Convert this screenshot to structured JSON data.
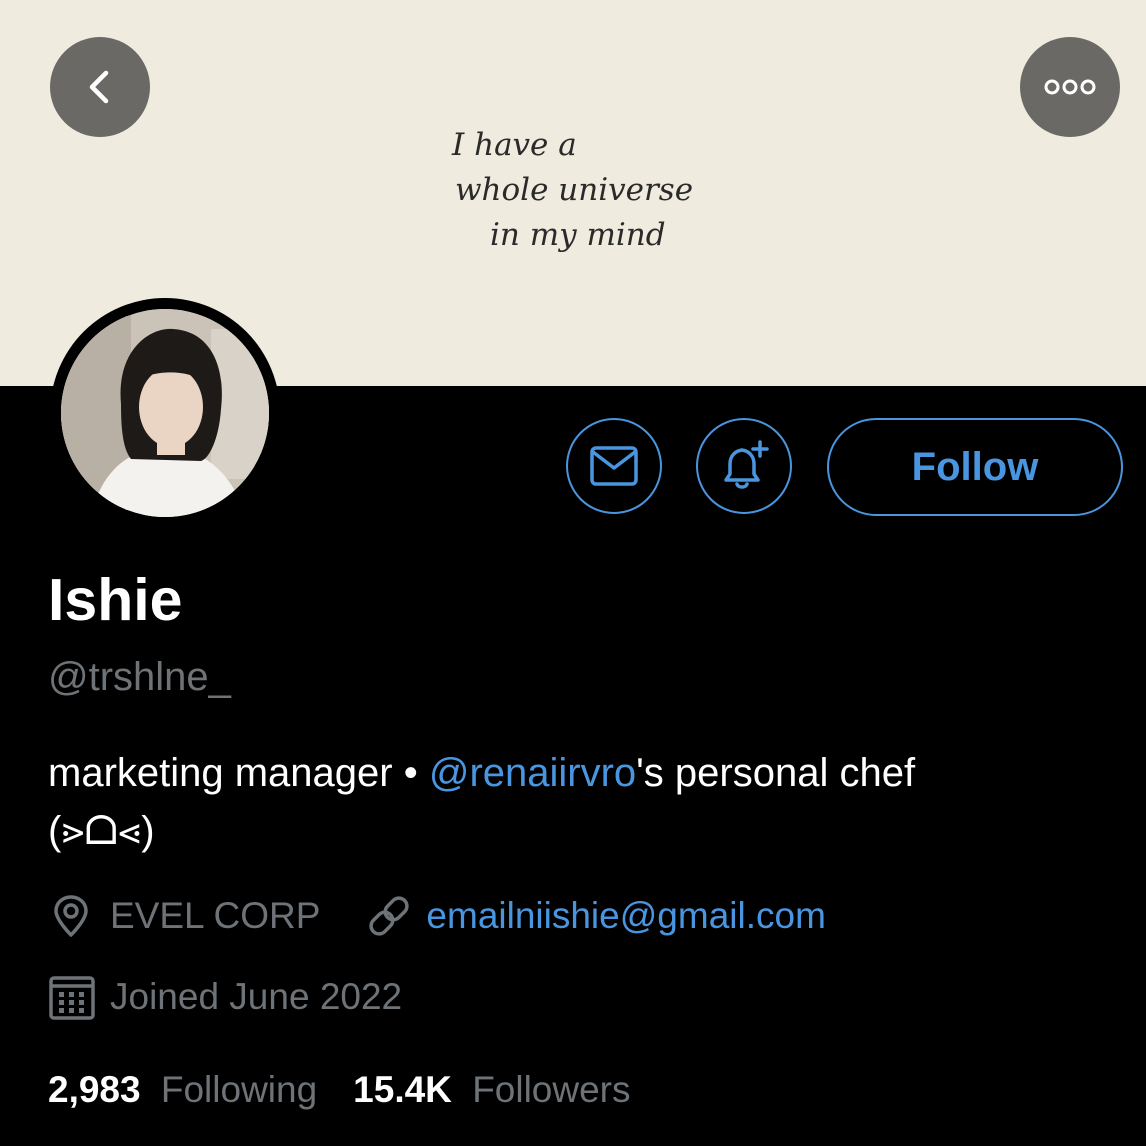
{
  "banner": {
    "note_lines": [
      "I  have  a",
      "whole  universe",
      "in  my  mind"
    ],
    "background_color": "#f0ebdf"
  },
  "nav": {
    "back_icon": "chevron-left-icon",
    "more_icon": "more-dots-icon"
  },
  "actions": {
    "message_icon": "mail-icon",
    "notify_icon": "bell-plus-icon",
    "follow_label": "Follow"
  },
  "profile": {
    "display_name": "Ishie",
    "handle": "@trshlne_",
    "bio_prefix": "marketing manager • ",
    "bio_mention": "@renaiirvro",
    "bio_suffix": "'s personal chef",
    "bio_line2": "(⋗ᗝ⋖)",
    "location": "EVEL CORP",
    "website": "emailniishie@gmail.com",
    "joined": "Joined June 2022"
  },
  "stats": {
    "following_count": "2,983",
    "following_label": "Following",
    "followers_count": "15.4K",
    "followers_label": "Followers"
  },
  "colors": {
    "accent": "#4a95e0",
    "muted": "#6e7378",
    "background": "#000000"
  }
}
